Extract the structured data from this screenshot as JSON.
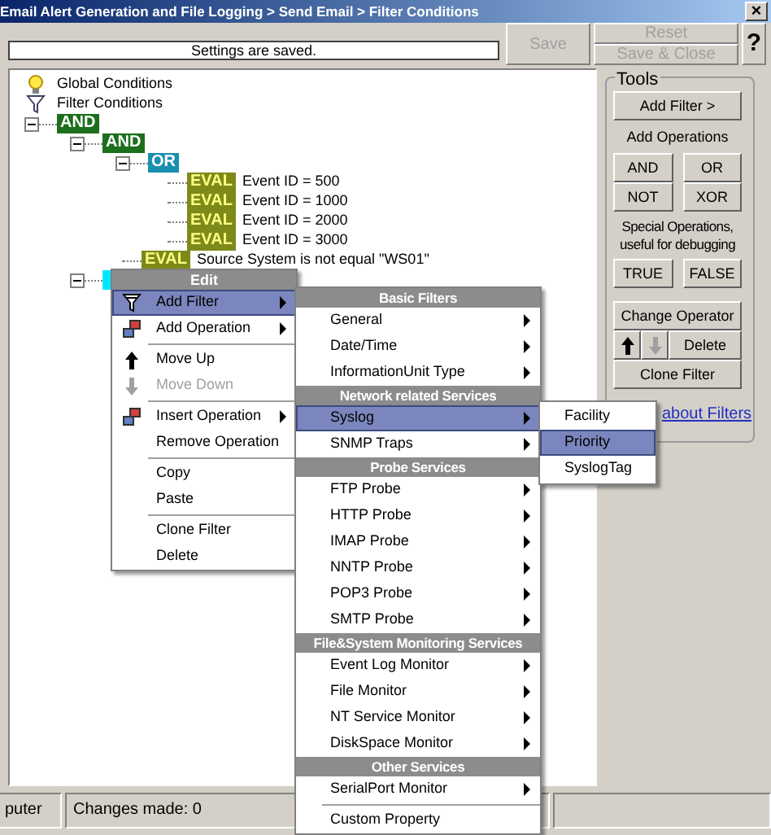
{
  "window": {
    "title": "Email Alert Generation and File Logging > Send Email > Filter Conditions",
    "close": "×"
  },
  "toolbar": {
    "message": "Settings are saved.",
    "save": {
      "label": "Save",
      "disabled": true
    },
    "reset": {
      "label": "Reset",
      "disabled": true
    },
    "save_close": {
      "label": "Save & Close",
      "disabled": true
    },
    "help": "?"
  },
  "tree": {
    "roots": [
      {
        "kind": "global",
        "label": "Global Conditions"
      },
      {
        "kind": "filters",
        "label": "Filter Conditions"
      }
    ],
    "conditions": [
      {
        "kind": "and",
        "label": "AND",
        "expanded": true,
        "children": [
          {
            "kind": "and",
            "label": "AND",
            "expanded": true,
            "children": [
              {
                "kind": "or",
                "label": "OR",
                "expanded": true,
                "children": [
                  {
                    "kind": "eval",
                    "label": "EVAL",
                    "text": "Event ID = 500"
                  },
                  {
                    "kind": "eval",
                    "label": "EVAL",
                    "text": "Event ID = 1000"
                  },
                  {
                    "kind": "eval",
                    "label": "EVAL",
                    "text": "Event ID = 2000"
                  },
                  {
                    "kind": "eval",
                    "label": "EVAL",
                    "text": "Event ID = 3000"
                  }
                ]
              },
              {
                "kind": "eval",
                "label": "EVAL",
                "text": "Source System is not equal \"WS01\""
              }
            ]
          },
          {
            "kind": "operator",
            "selected": true,
            "expanded": true
          }
        ]
      }
    ]
  },
  "tools": {
    "title": "Tools",
    "add_filter": "Add Filter >",
    "ops_label": "Add Operations",
    "ops": [
      "AND",
      "OR",
      "NOT",
      "XOR"
    ],
    "special_label": "Special Operations, useful for debugging",
    "special": [
      "TRUE",
      "FALSE"
    ],
    "change": "Change Operator",
    "arrows": [
      {
        "kind": "up",
        "disabled": false
      },
      {
        "kind": "down",
        "disabled": true
      }
    ],
    "delete": "Delete",
    "clone": "Clone Filter",
    "link": "about Filters"
  },
  "context_menu": {
    "header": "Edit",
    "items": [
      {
        "kind": "add-filter",
        "label": "Add Filter",
        "submenu": true,
        "selected": true,
        "disabled": false
      },
      {
        "kind": "add-operation",
        "label": "Add Operation",
        "submenu": true,
        "selected": false,
        "disabled": false
      },
      {
        "kind": "separator"
      },
      {
        "kind": "move-up",
        "label": "Move Up",
        "submenu": false,
        "selected": false,
        "disabled": false
      },
      {
        "kind": "move-down",
        "label": "Move Down",
        "submenu": false,
        "selected": false,
        "disabled": true
      },
      {
        "kind": "separator"
      },
      {
        "kind": "add-operation",
        "label": "Insert Operation",
        "submenu": true,
        "selected": false,
        "disabled": false
      },
      {
        "kind": "item",
        "label": "Remove Operation",
        "submenu": false,
        "selected": false,
        "disabled": false
      },
      {
        "kind": "separator"
      },
      {
        "kind": "item",
        "label": "Copy",
        "submenu": false,
        "selected": false,
        "disabled": false
      },
      {
        "kind": "item",
        "label": "Paste",
        "submenu": false,
        "selected": false,
        "disabled": false
      },
      {
        "kind": "separator"
      },
      {
        "kind": "item",
        "label": "Clone Filter",
        "submenu": false,
        "selected": false,
        "disabled": false
      },
      {
        "kind": "item",
        "label": "Delete",
        "submenu": false,
        "selected": false,
        "disabled": false
      }
    ]
  },
  "filter_menu": {
    "items": [
      {
        "kind": "header",
        "label": "Basic Filters"
      },
      {
        "kind": "item",
        "label": "General",
        "submenu": true,
        "selected": false
      },
      {
        "kind": "item",
        "label": "Date/Time",
        "submenu": true,
        "selected": false
      },
      {
        "kind": "item",
        "label": "InformationUnit Type",
        "submenu": true,
        "selected": false
      },
      {
        "kind": "header",
        "label": "Network related Services"
      },
      {
        "kind": "item",
        "label": "Syslog",
        "submenu": true,
        "selected": true
      },
      {
        "kind": "item",
        "label": "SNMP Traps",
        "submenu": true,
        "selected": false
      },
      {
        "kind": "header",
        "label": "Probe Services"
      },
      {
        "kind": "item",
        "label": "FTP Probe",
        "submenu": true,
        "selected": false
      },
      {
        "kind": "item",
        "label": "HTTP Probe",
        "submenu": true,
        "selected": false
      },
      {
        "kind": "item",
        "label": "IMAP Probe",
        "submenu": true,
        "selected": false
      },
      {
        "kind": "item",
        "label": "NNTP Probe",
        "submenu": true,
        "selected": false
      },
      {
        "kind": "item",
        "label": "POP3 Probe",
        "submenu": true,
        "selected": false
      },
      {
        "kind": "item",
        "label": "SMTP Probe",
        "submenu": true,
        "selected": false
      },
      {
        "kind": "header",
        "label": "File&System Monitoring Services"
      },
      {
        "kind": "item",
        "label": "Event Log Monitor",
        "submenu": true,
        "selected": false
      },
      {
        "kind": "item",
        "label": "File Monitor",
        "submenu": true,
        "selected": false
      },
      {
        "kind": "item",
        "label": "NT Service Monitor",
        "submenu": true,
        "selected": false
      },
      {
        "kind": "item",
        "label": "DiskSpace Monitor",
        "submenu": true,
        "selected": false
      },
      {
        "kind": "header",
        "label": "Other Services"
      },
      {
        "kind": "item",
        "label": "SerialPort Monitor",
        "submenu": true,
        "selected": false
      },
      {
        "kind": "separator"
      },
      {
        "kind": "item",
        "label": "Custom Property",
        "submenu": false,
        "selected": false
      }
    ]
  },
  "syslog_menu": {
    "items": [
      {
        "kind": "item",
        "label": "Facility",
        "submenu": false,
        "selected": false
      },
      {
        "kind": "item",
        "label": "Priority",
        "submenu": false,
        "selected": true
      },
      {
        "kind": "item",
        "label": "SyslogTag",
        "submenu": false,
        "selected": false
      }
    ]
  },
  "status_bar": {
    "panels": [
      "puter",
      "Changes made: 0"
    ]
  }
}
